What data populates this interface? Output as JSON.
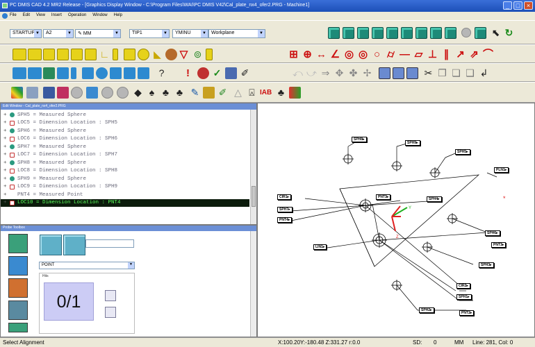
{
  "title": "PC DMIS CAD 4.2 MR2 Release - [Graphics Display Window - C:\\Program Files\\WAI\\PC DMIS V42\\Cal_plate_nx4_ofer2.PRG - Machine1]",
  "menu": [
    "File",
    "Edit",
    "View",
    "Insert",
    "Operation",
    "Window",
    "Help"
  ],
  "toolbar": {
    "probe": "STARTUP",
    "tip": "A2",
    "units": "MM",
    "probe_tip": "TIP1",
    "view_set": "YMINU",
    "workplane": "Workplane"
  },
  "edit_window": {
    "title": "Edit Window - Cal_plate_nx4_ofer2.PRG",
    "commands": [
      {
        "icon": "sphere-icon",
        "text": "SPH5 = Measured Sphere"
      },
      {
        "icon": "location-icon",
        "text": "LOC5 = Dimension Location : SPH5"
      },
      {
        "icon": "sphere-icon",
        "text": "SPH6 = Measured Sphere"
      },
      {
        "icon": "location-icon",
        "text": "LOC6 = Dimension Location : SPH6"
      },
      {
        "icon": "sphere-icon",
        "text": "SPH7 = Measured Sphere"
      },
      {
        "icon": "location-icon",
        "text": "LOC7 = Dimension Location : SPH7"
      },
      {
        "icon": "sphere-icon",
        "text": "SPH8 = Measured Sphere"
      },
      {
        "icon": "location-icon",
        "text": "LOC8 = Dimension Location : SPH8"
      },
      {
        "icon": "sphere-icon",
        "text": "SPH9 = Measured Sphere"
      },
      {
        "icon": "location-icon",
        "text": "LOC9 = Dimension Location : SPH9"
      },
      {
        "icon": "point-icon",
        "text": "PNT4 = Measured Point"
      },
      {
        "icon": "location-icon",
        "text": "LOC10 = Dimension Location : PNT4",
        "selected": true
      }
    ]
  },
  "probe_panel": {
    "title": "Probe Toolbox",
    "feature_type": "POINT",
    "hits_label": "Hits",
    "hits_count": "0/1"
  },
  "graphics": {
    "labels": [
      "SPH8",
      "SPH9",
      "SPH5",
      "PLN1",
      "CIR1",
      "SPH7",
      "PNT4",
      "PNT3",
      "SPH4",
      "LIN1",
      "SPH6",
      "PNT3",
      "SPH3",
      "CIR2",
      "SPH1",
      "SPH2",
      "PNT2"
    ]
  },
  "status": {
    "message": "Select Alignment",
    "coords": "X:100.20Y:-180.48 Z:331.27 r:0.0",
    "sd": "SD:",
    "sd_value": "0",
    "units": "MM",
    "line": "Line: 281, Col: 0"
  },
  "colors": {
    "title_bar": "#1c4fb8",
    "selected_command_bg": "#0c1c0c",
    "selected_command_text": "#5cff5c",
    "axis_x": "#e02020",
    "axis_y": "#20b020",
    "axis_z": "#e02020"
  }
}
